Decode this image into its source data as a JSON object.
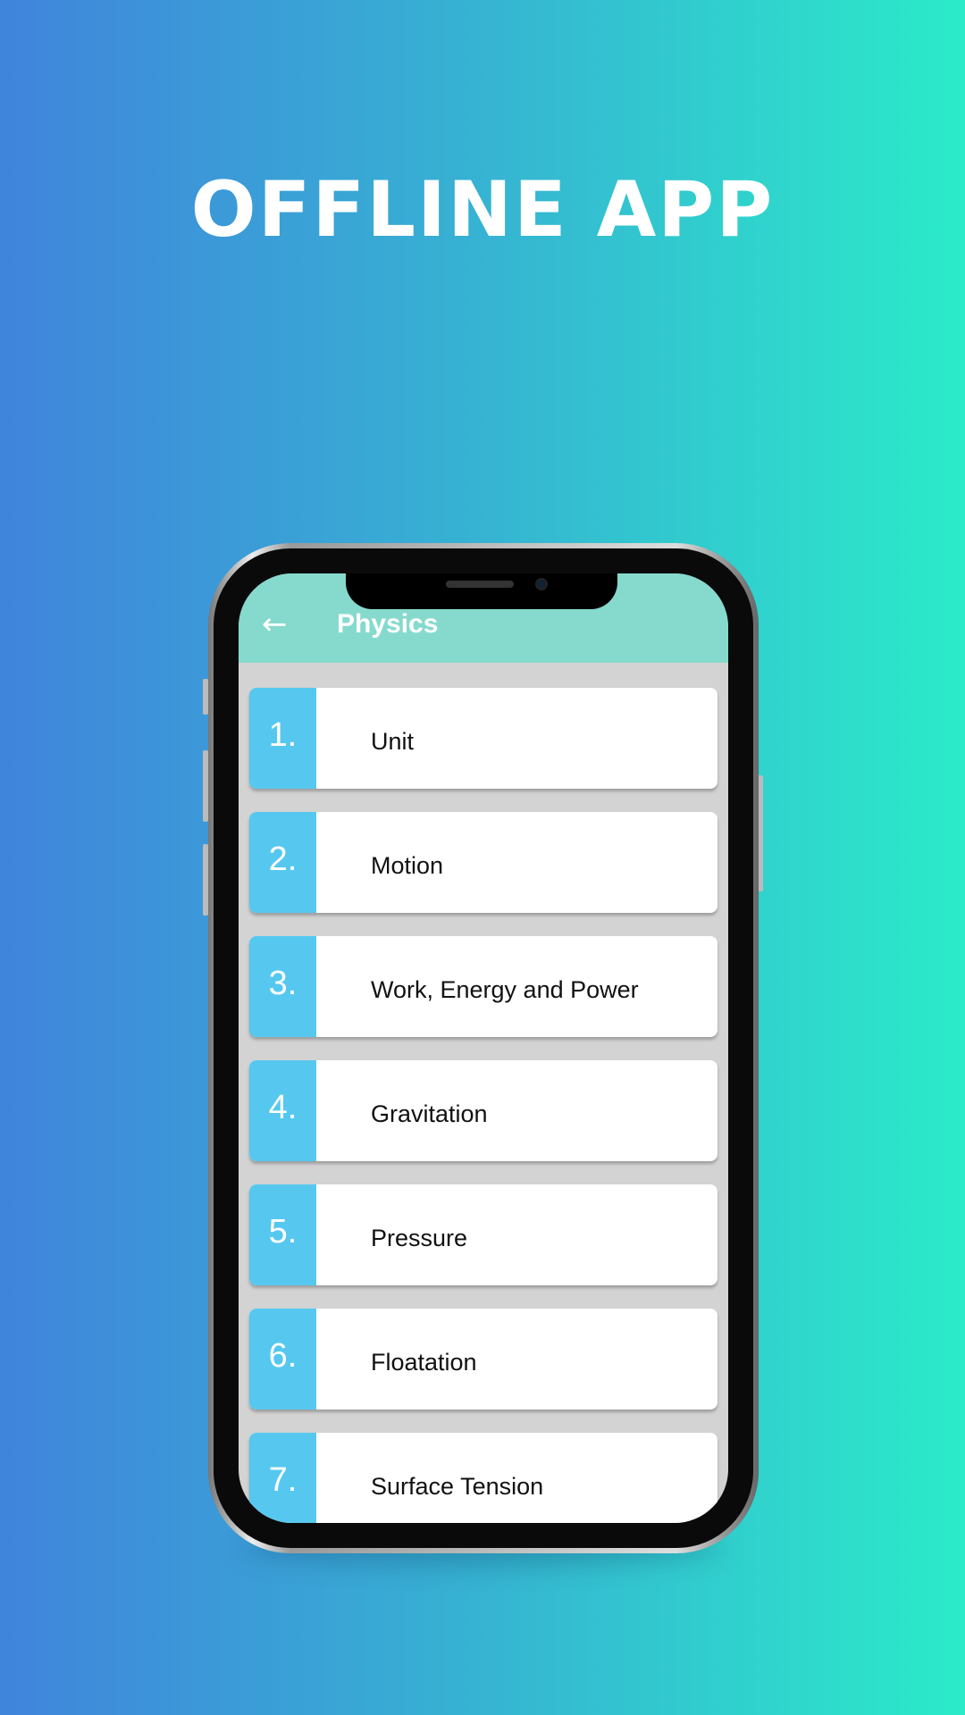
{
  "headline": "OFFLINE APP",
  "app": {
    "title": "Physics",
    "back_icon": "arrow-left-icon"
  },
  "chapters": [
    {
      "number": "1.",
      "title": "Unit"
    },
    {
      "number": "2.",
      "title": "Motion"
    },
    {
      "number": "3.",
      "title": "Work, Energy and Power"
    },
    {
      "number": "4.",
      "title": "Gravitation"
    },
    {
      "number": "5.",
      "title": "Pressure"
    },
    {
      "number": "6.",
      "title": "Floatation"
    },
    {
      "number": "7.",
      "title": "Surface Tension"
    }
  ],
  "colors": {
    "appbar": "#86dacd",
    "number_column": "#56c8ef",
    "bg_left": "#4084dc",
    "bg_right": "#2bebc9"
  }
}
